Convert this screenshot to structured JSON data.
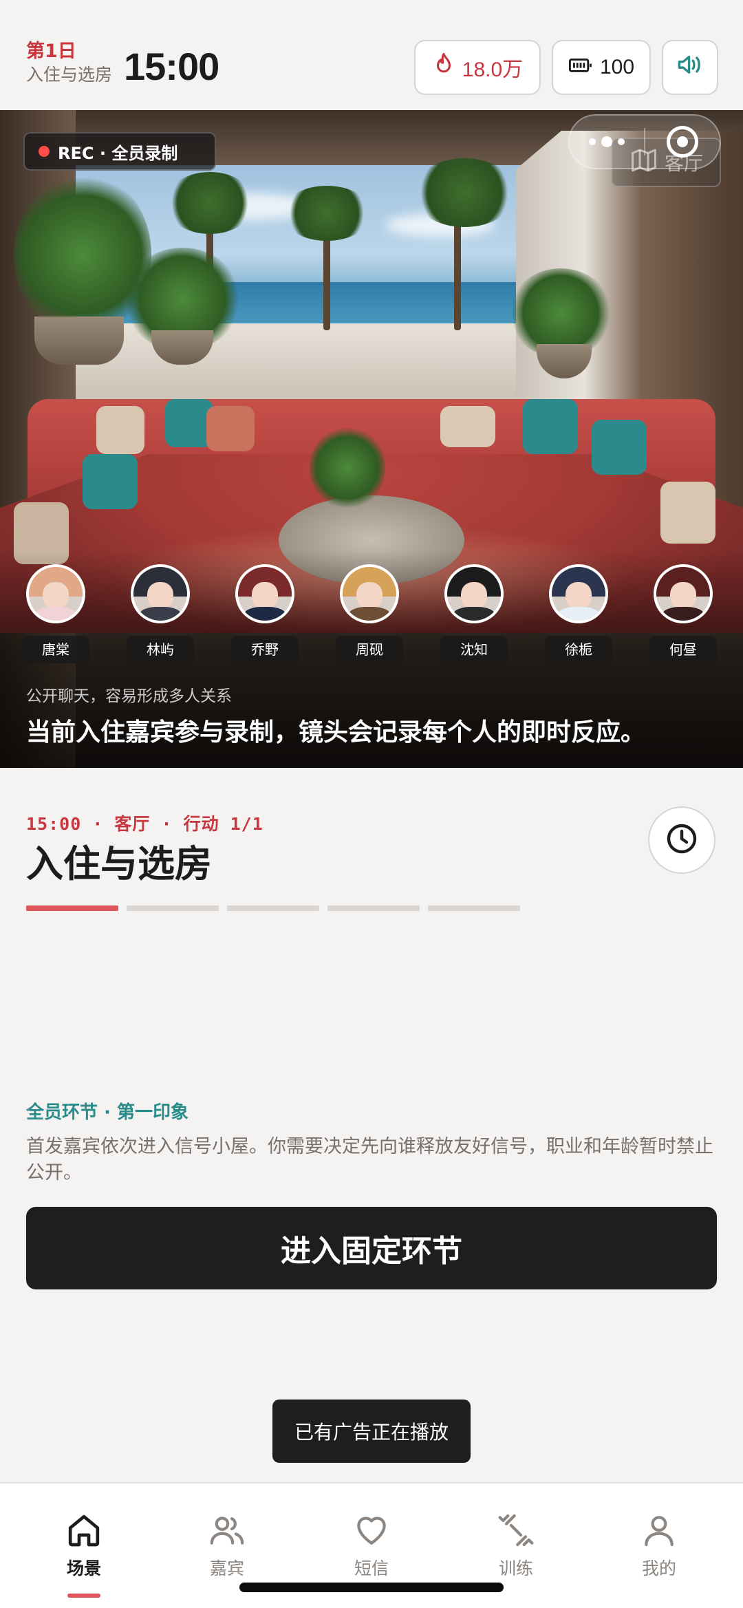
{
  "status": {
    "day": "第1日",
    "phase": "入住与选房",
    "time": "15:00",
    "heat": "18.0万",
    "energy": "100"
  },
  "scene": {
    "rec_label": "REC · 全员录制",
    "location": "客厅",
    "hint": "公开聊天，容易形成多人关系",
    "caption": "当前入住嘉宾参与录制，镜头会记录每个人的即时反应。",
    "guests": [
      {
        "name": "唐棠",
        "hair": "#e0a886",
        "body": "#f1d2d6"
      },
      {
        "name": "林屿",
        "hair": "#2c2f3a",
        "body": "#3b3e4a"
      },
      {
        "name": "乔野",
        "hair": "#7a2a2a",
        "body": "#1e2a44"
      },
      {
        "name": "周砚",
        "hair": "#d6a25a",
        "body": "#6e4f35"
      },
      {
        "name": "沈知",
        "hair": "#1c1c1c",
        "body": "#2a2a2a"
      },
      {
        "name": "徐栀",
        "hair": "#2b3550",
        "body": "#e8eef6"
      },
      {
        "name": "何昼",
        "hair": "#5a1f1f",
        "body": "#3a1e1e"
      }
    ]
  },
  "stage": {
    "meta": "15:00 · 客厅 · 行动 1/1",
    "title": "入住与选房",
    "progress_done": 1,
    "progress_total": 5,
    "section_label": "全员环节 · 第一印象",
    "section_desc": "首发嘉宾依次进入信号小屋。你需要决定先向谁释放友好信号，职业和年龄暂时禁止公开。",
    "primary_button": "进入固定环节"
  },
  "toast": "已有广告正在播放",
  "tabs": [
    {
      "label": "场景",
      "icon": "home-icon",
      "active": true
    },
    {
      "label": "嘉宾",
      "icon": "users-icon",
      "active": false
    },
    {
      "label": "短信",
      "icon": "heart-icon",
      "active": false
    },
    {
      "label": "训练",
      "icon": "dumbbell-icon",
      "active": false
    },
    {
      "label": "我的",
      "icon": "user-icon",
      "active": false
    }
  ],
  "colors": {
    "accent_red": "#c8373f",
    "accent_teal": "#2a8c8a",
    "dark": "#1e1e20"
  }
}
